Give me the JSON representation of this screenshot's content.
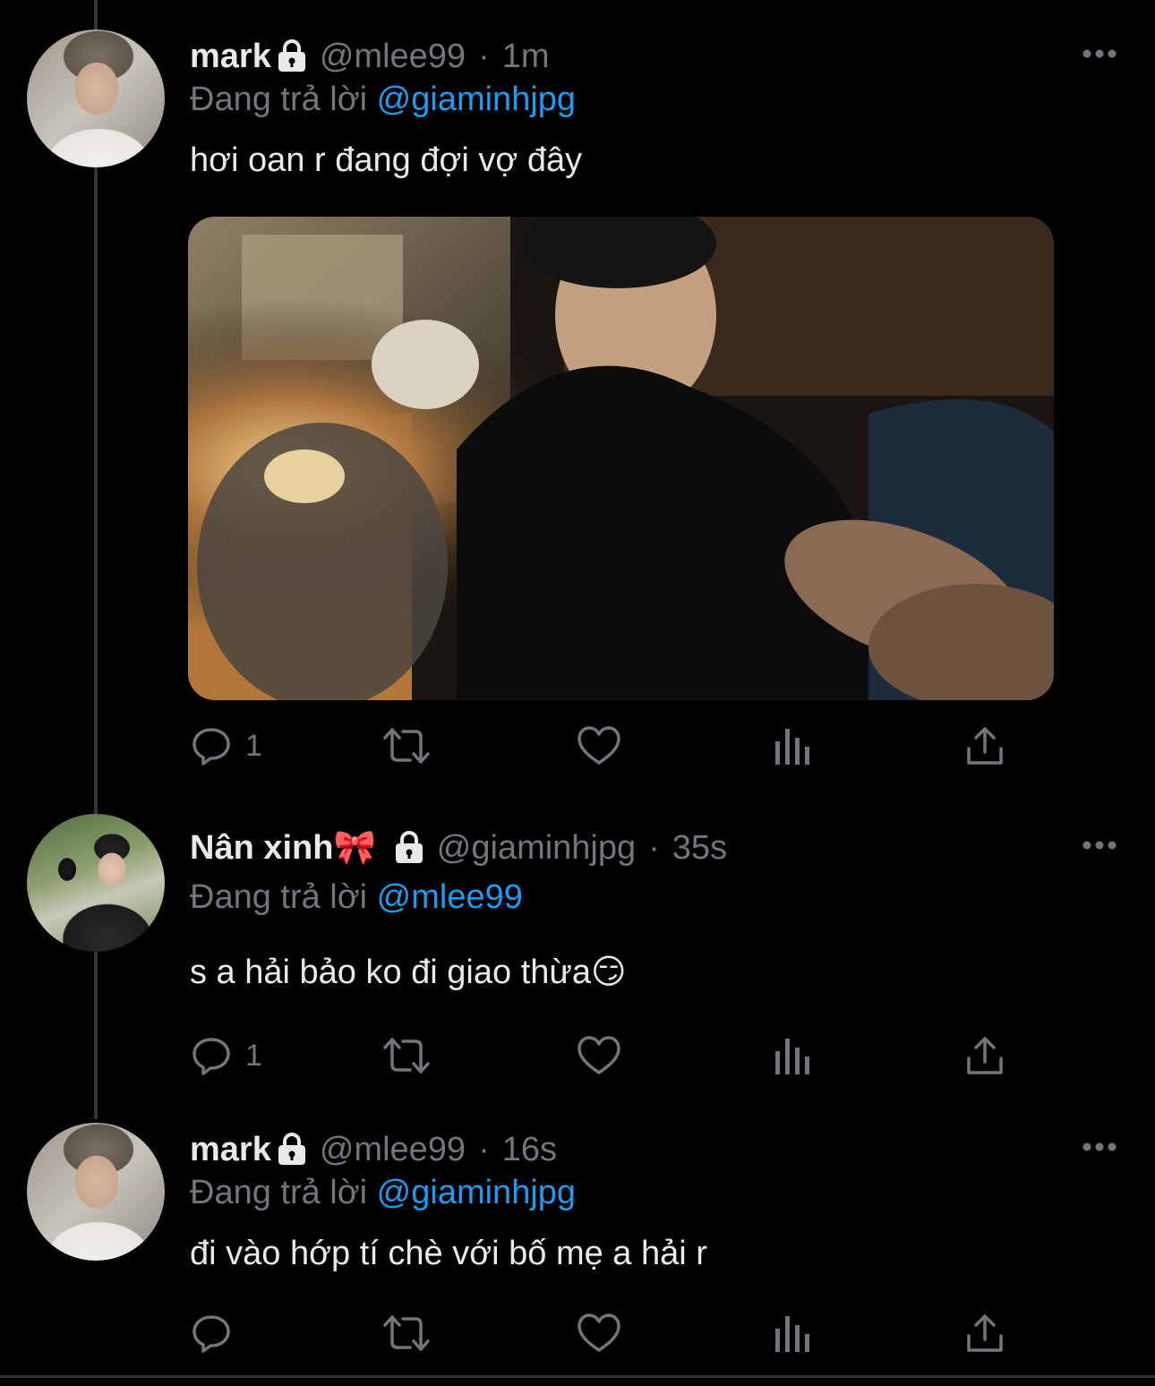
{
  "colors": {
    "background": "#000000",
    "text": "#e7e9ea",
    "muted": "#71767b",
    "mention": "#1d9bf0"
  },
  "replying_prefix": "Đang trả lời",
  "tweets": [
    {
      "name": "mark",
      "handle": "@mlee99",
      "separator": "·",
      "time": "1m",
      "reply_to": "@giaminhjpg",
      "text": "hơi oan r đang đợi vợ đây",
      "has_media": true,
      "reply_count": "1"
    },
    {
      "name": "Nân xinh🎀",
      "handle": "@giaminhjpg",
      "separator": "·",
      "time": "35s",
      "reply_to": "@mlee99",
      "text": "s a hải bảo ko đi giao thừa😏",
      "has_media": false,
      "reply_count": "1"
    },
    {
      "name": "mark",
      "handle": "@mlee99",
      "separator": "·",
      "time": "16s",
      "reply_to": "@giaminhjpg",
      "text": "đi vào hớp tí chè với bố mẹ a hải r",
      "has_media": false,
      "reply_count": ""
    }
  ],
  "icons": {
    "lock": "lock-icon",
    "more": "more-icon",
    "reply": "reply-icon",
    "retweet": "retweet-icon",
    "like": "heart-icon",
    "views": "views-icon",
    "share": "share-icon"
  }
}
